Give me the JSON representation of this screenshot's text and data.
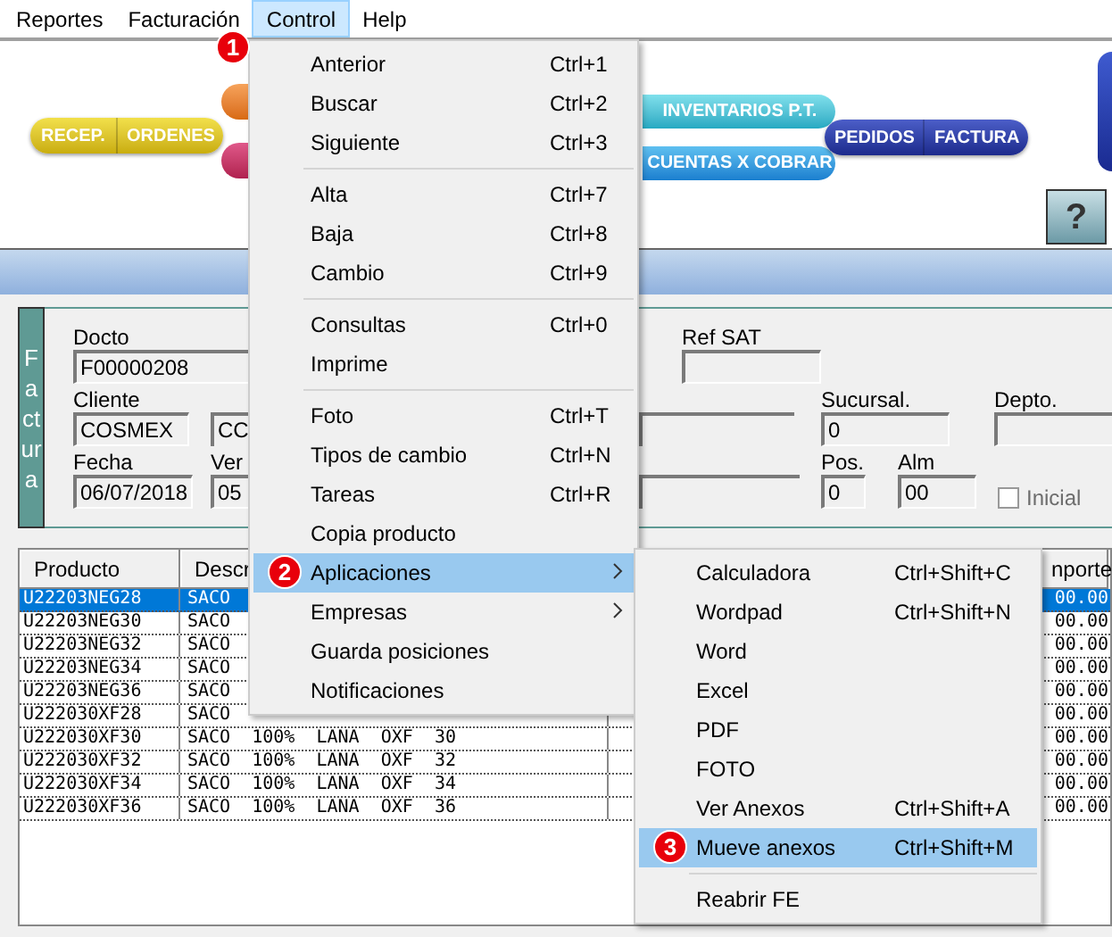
{
  "menubar": [
    {
      "label": "Reportes",
      "selected": false
    },
    {
      "label": "Facturación",
      "selected": false
    },
    {
      "label": "Control",
      "selected": true
    },
    {
      "label": "Help",
      "selected": false
    }
  ],
  "toolbar": {
    "left_buttons": [
      "RECEP.",
      "ORDENES"
    ],
    "middle_buttons": [
      "INVENTARIOS P.T.",
      "CUENTAS X COBRAR"
    ],
    "right_buttons": [
      "PEDIDOS",
      "FACTURA"
    ],
    "help_button": "?"
  },
  "form": {
    "side_label": "Factura",
    "docto": {
      "label": "Docto",
      "value": "F00000208"
    },
    "ref_sat": {
      "label": "Ref SAT"
    },
    "cliente": {
      "label": "Cliente",
      "value": "COSMEX",
      "value_2": "CC"
    },
    "sucursal": {
      "label": "Sucursal.",
      "value": "0"
    },
    "depto": {
      "label": "Depto."
    },
    "fecha": {
      "label": "Fecha",
      "value": "06/07/2018"
    },
    "vendedor": {
      "label": "Ver",
      "value": "05"
    },
    "pos": {
      "label": "Pos.",
      "value": "0"
    },
    "alm": {
      "label": "Alm",
      "value": "00"
    },
    "inicial": {
      "label": "Inicial",
      "checked": false
    }
  },
  "table": {
    "columns": [
      "Producto",
      "Descr",
      "nporte"
    ],
    "rows": [
      {
        "producto": "U22203NEG28",
        "descripcion": "SACO",
        "importe": "00.00",
        "selected": true
      },
      {
        "producto": "U22203NEG30",
        "descripcion": "SACO",
        "importe": "00.00",
        "selected": false
      },
      {
        "producto": "U22203NEG32",
        "descripcion": "SACO",
        "importe": "00.00",
        "selected": false
      },
      {
        "producto": "U22203NEG34",
        "descripcion": "SACO",
        "importe": "00.00",
        "selected": false
      },
      {
        "producto": "U22203NEG36",
        "descripcion": "SACO",
        "importe": "00.00",
        "selected": false
      },
      {
        "producto": "U222030XF28",
        "descripcion": "SACO",
        "importe": "00.00",
        "selected": false
      },
      {
        "producto": "U222030XF30",
        "descripcion": "SACO 100% LANA OXF 30",
        "importe": "00.00",
        "selected": false
      },
      {
        "producto": "U222030XF32",
        "descripcion": "SACO 100% LANA OXF 32",
        "importe": "00.00",
        "selected": false
      },
      {
        "producto": "U222030XF34",
        "descripcion": "SACO 100% LANA OXF 34",
        "importe": "00.00",
        "selected": false
      },
      {
        "producto": "U222030XF36",
        "descripcion": "SACO 100% LANA OXF 36",
        "importe": "00.00",
        "selected": false
      }
    ]
  },
  "control_menu": [
    {
      "kind": "item",
      "label": "Anterior",
      "shortcut": "Ctrl+1",
      "selected": false,
      "submenu": false
    },
    {
      "kind": "item",
      "label": "Buscar",
      "shortcut": "Ctrl+2",
      "selected": false,
      "submenu": false
    },
    {
      "kind": "item",
      "label": "Siguiente",
      "shortcut": "Ctrl+3",
      "selected": false,
      "submenu": false
    },
    {
      "kind": "separator"
    },
    {
      "kind": "item",
      "label": "Alta",
      "shortcut": "Ctrl+7",
      "selected": false,
      "submenu": false
    },
    {
      "kind": "item",
      "label": "Baja",
      "shortcut": "Ctrl+8",
      "selected": false,
      "submenu": false
    },
    {
      "kind": "item",
      "label": "Cambio",
      "shortcut": "Ctrl+9",
      "selected": false,
      "submenu": false
    },
    {
      "kind": "separator"
    },
    {
      "kind": "item",
      "label": "Consultas",
      "shortcut": "Ctrl+0",
      "selected": false,
      "submenu": false
    },
    {
      "kind": "item",
      "label": "Imprime",
      "selected": false,
      "submenu": false
    },
    {
      "kind": "separator"
    },
    {
      "kind": "item",
      "label": "Foto",
      "shortcut": "Ctrl+T",
      "selected": false,
      "submenu": false
    },
    {
      "kind": "item",
      "label": "Tipos de cambio",
      "shortcut": "Ctrl+N",
      "selected": false,
      "submenu": false
    },
    {
      "kind": "item",
      "label": "Tareas",
      "shortcut": "Ctrl+R",
      "selected": false,
      "submenu": false
    },
    {
      "kind": "item",
      "label": "Copia producto",
      "selected": false,
      "submenu": false
    },
    {
      "kind": "item",
      "label": "Aplicaciones",
      "selected": true,
      "submenu": true,
      "badge": "2"
    },
    {
      "kind": "item",
      "label": "Empresas",
      "selected": false,
      "submenu": true
    },
    {
      "kind": "item",
      "label": "Guarda posiciones",
      "selected": false,
      "submenu": false
    },
    {
      "kind": "item",
      "label": "Notificaciones",
      "selected": false,
      "submenu": false
    }
  ],
  "aplicaciones_menu": [
    {
      "kind": "item",
      "label": "Calculadora",
      "shortcut": "Ctrl+Shift+C",
      "selected": false
    },
    {
      "kind": "item",
      "label": "Wordpad",
      "shortcut": "Ctrl+Shift+N",
      "selected": false
    },
    {
      "kind": "item",
      "label": "Word",
      "selected": false
    },
    {
      "kind": "item",
      "label": "Excel",
      "selected": false
    },
    {
      "kind": "item",
      "label": "PDF",
      "selected": false
    },
    {
      "kind": "item",
      "label": "FOTO",
      "selected": false
    },
    {
      "kind": "item",
      "label": "Ver Anexos",
      "shortcut": "Ctrl+Shift+A",
      "selected": false
    },
    {
      "kind": "item",
      "label": "Mueve anexos",
      "shortcut": "Ctrl+Shift+M",
      "selected": true,
      "badge": "3"
    },
    {
      "kind": "separator"
    },
    {
      "kind": "item",
      "label": "Reabrir FE",
      "selected": false
    }
  ],
  "menu_badge": "1"
}
